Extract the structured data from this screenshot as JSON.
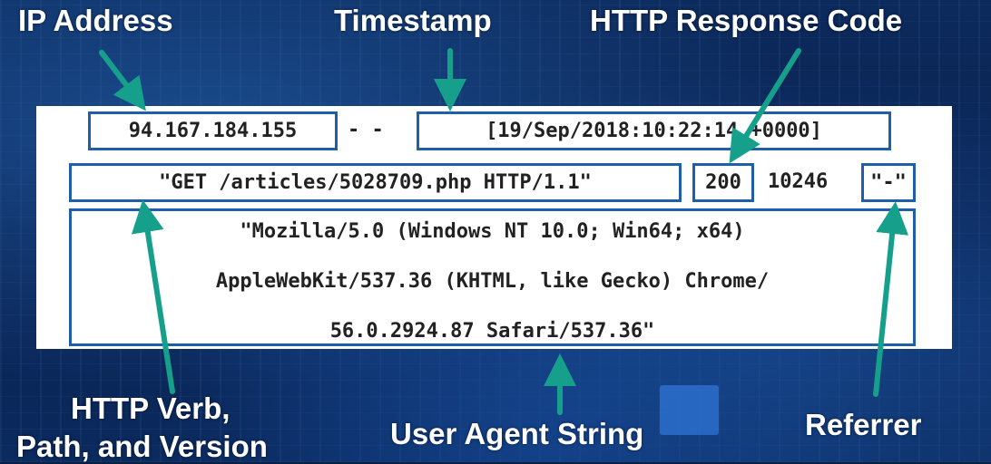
{
  "labels": {
    "ip": "IP Address",
    "timestamp": "Timestamp",
    "response_code": "HTTP Response Code",
    "verb_line1": "HTTP Verb,",
    "verb_line2": "Path, and Version",
    "user_agent": "User Agent String",
    "referrer": "Referrer"
  },
  "log": {
    "ip": "94.167.184.155",
    "dashes": "- -",
    "timestamp": "[19/Sep/2018:10:22:14 +0000]",
    "request": "\"GET /articles/5028709.php HTTP/1.1\"",
    "status": "200",
    "size": "10246",
    "referrer": "\"-\"",
    "user_agent_lines": [
      "\"Mozilla/5.0 (Windows NT 10.0; Win64; x64)",
      "AppleWebKit/537.36 (KHTML, like Gecko) Chrome/",
      "56.0.2924.87 Safari/537.36\""
    ]
  },
  "colors": {
    "arrow": "#16a08c",
    "box_border": "#1f5ea8",
    "background": "#0a1f44"
  }
}
